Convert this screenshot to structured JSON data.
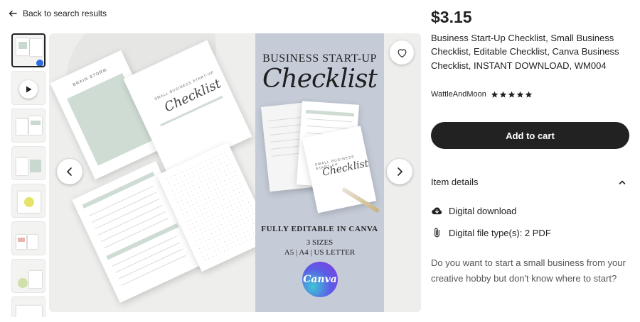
{
  "nav": {
    "back_label": "Back to search results"
  },
  "gallery": {
    "thumbnail_texts": [
      "",
      "",
      "",
      "",
      "",
      "",
      "",
      ""
    ],
    "cover": {
      "heading": "BUSINESS START-UP",
      "script_title": "Checklist",
      "editable_note": "FULLY EDITABLE IN CANVA",
      "sizes_count": "3 SIZES",
      "sizes_list": "A5 | A4 | US LETTER",
      "canva_logo_text": "Canva"
    },
    "mockup_labels": {
      "brainstorm": "BRAIN STORM",
      "small_business": "SMALL BUSINESS START-UP",
      "script": "Checklist"
    }
  },
  "listing": {
    "price": "$3.15",
    "title": "Business Start-Up Checklist, Small Business Checklist, Editable Checklist, Canva Business Checklist, INSTANT DOWNLOAD, WM004",
    "shop_name": "WattleAndMoon",
    "rating_stars": 5,
    "add_to_cart_label": "Add to cart"
  },
  "details": {
    "heading": "Item details",
    "items": [
      {
        "icon": "cloud-download-icon",
        "text": "Digital download"
      },
      {
        "icon": "paperclip-icon",
        "text": "Digital file type(s): 2 PDF"
      }
    ],
    "description": "Do you want to start a small business from your creative hobby but don't know where to start?"
  },
  "colors": {
    "button_bg": "#222222",
    "cover_bg": "#c5ccd8",
    "accent_green": "#cfdcd4"
  }
}
